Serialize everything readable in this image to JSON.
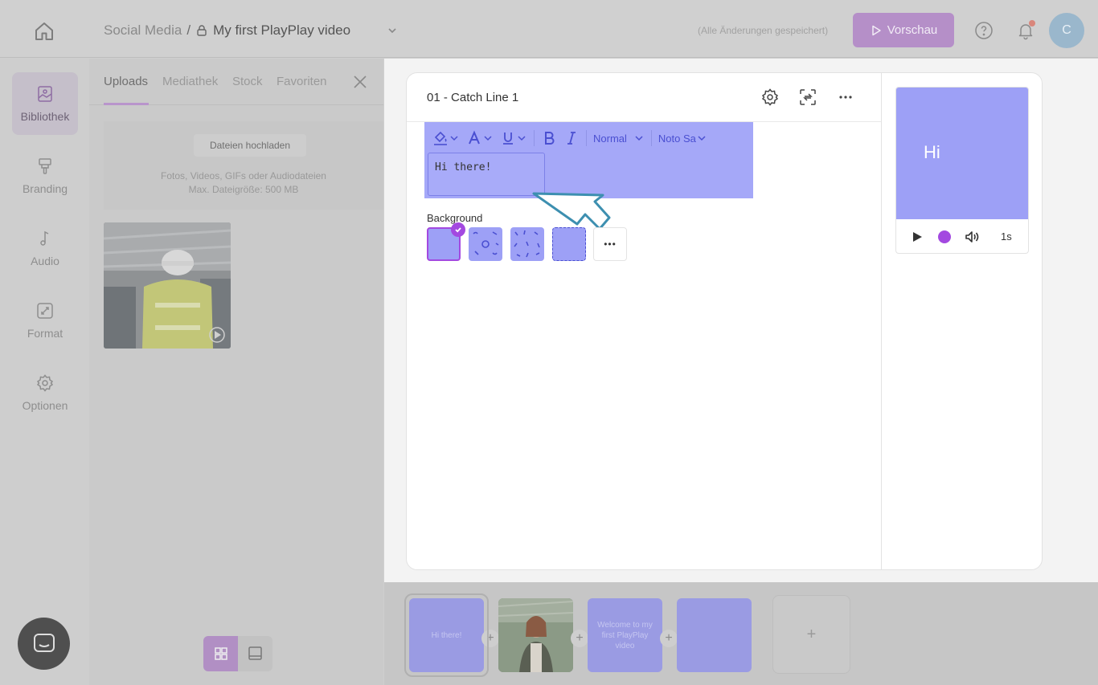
{
  "header": {
    "project_path": "Social Media",
    "path_separator": "/",
    "video_title": "My first PlayPlay video",
    "saved_status": "(Alle Änderungen gespeichert)",
    "preview_label": "Vorschau",
    "avatar_initial": "C"
  },
  "rail": {
    "items": [
      {
        "label": "Bibliothek",
        "icon": "image-icon",
        "active": true
      },
      {
        "label": "Branding",
        "icon": "paint-roller-icon"
      },
      {
        "label": "Audio",
        "icon": "music-note-icon"
      },
      {
        "label": "Format",
        "icon": "resize-icon"
      },
      {
        "label": "Optionen",
        "icon": "gear-icon"
      }
    ]
  },
  "library": {
    "tabs": [
      "Uploads",
      "Mediathek",
      "Stock",
      "Favoriten"
    ],
    "active_tab": "Uploads",
    "upload_button": "Dateien hochladen",
    "upload_hint_line1": "Fotos, Videos, GIFs oder Audiodateien",
    "upload_hint_line2": "Max. Dateigröße: 500 MB"
  },
  "editor": {
    "scene_title": "01 - Catch Line 1",
    "toolbar": {
      "size_label": "Normal",
      "font_label": "Noto Sa"
    },
    "text_value": "Hi there!",
    "background_label": "Background",
    "more_label": "•••"
  },
  "preview": {
    "text": "Hi",
    "duration": "1s"
  },
  "timeline": {
    "scenes": [
      {
        "label": "Hi there!"
      },
      {
        "label": ""
      },
      {
        "label": "Welcome to my first PlayPlay video"
      },
      {
        "label": ""
      }
    ],
    "add_label": "+"
  },
  "colors": {
    "accent": "#a349e0",
    "scene_bg": "#9da0f6",
    "text_highlight": "#4a4fd1"
  }
}
